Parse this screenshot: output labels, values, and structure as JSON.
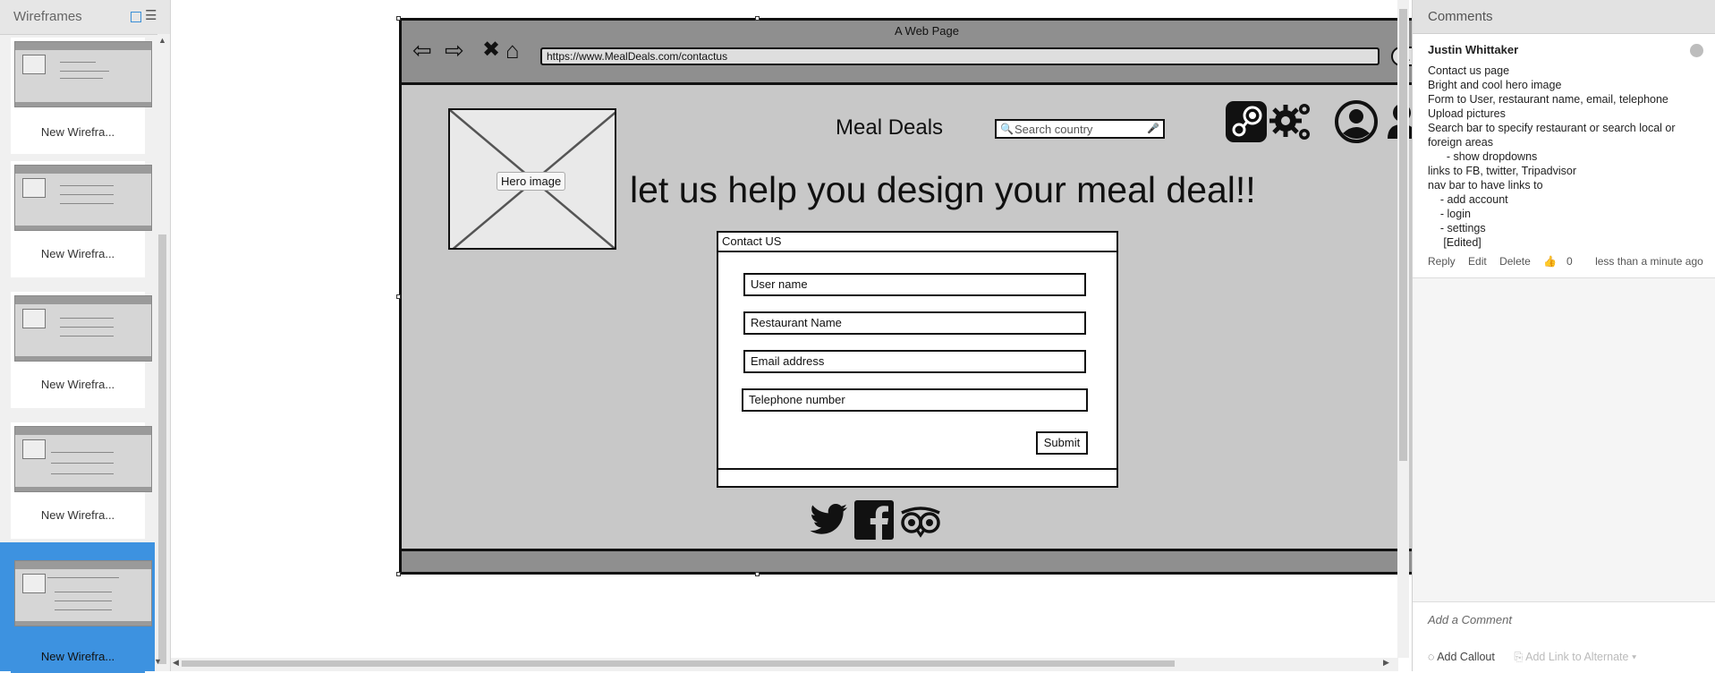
{
  "left_panel": {
    "title": "Wireframes",
    "thumbnails": [
      {
        "label": "New Wirefra..."
      },
      {
        "label": "New Wirefra..."
      },
      {
        "label": "New Wirefra..."
      },
      {
        "label": "New Wirefra..."
      },
      {
        "label": "New Wirefra..."
      }
    ]
  },
  "mockup": {
    "page_title": "A Web Page",
    "url": "https://www.MealDeals.com/contactus",
    "brand": "Meal Deals",
    "search_placeholder": "Search country",
    "hero_label": "Hero image",
    "headline": "let us help you design your meal deal!!",
    "form": {
      "title": "Contact US",
      "fields": [
        "User name",
        "Restaurant Name",
        "Email address",
        "Telephone number"
      ],
      "submit": "Submit"
    }
  },
  "comments": {
    "title": "Comments",
    "author": "Justin Whittaker",
    "lines": [
      "Contact us page",
      "Bright and cool hero image",
      "Form to User, restaurant name, email, telephone",
      "Upload pictures",
      "Search bar to specify restaurant or search local or",
      "foreign areas",
      "      - show dropdowns",
      "links to FB, twitter, Tripadvisor",
      "nav bar to have links to",
      "    - add account",
      "    - login",
      "    - settings",
      "     [Edited]"
    ],
    "actions": {
      "reply": "Reply",
      "edit": "Edit",
      "delete": "Delete",
      "likes": "0",
      "time": "less than a minute ago"
    },
    "add_comment_placeholder": "Add a Comment",
    "add_callout": "Add Callout",
    "add_link_alternate": "Add Link to Alternate"
  }
}
